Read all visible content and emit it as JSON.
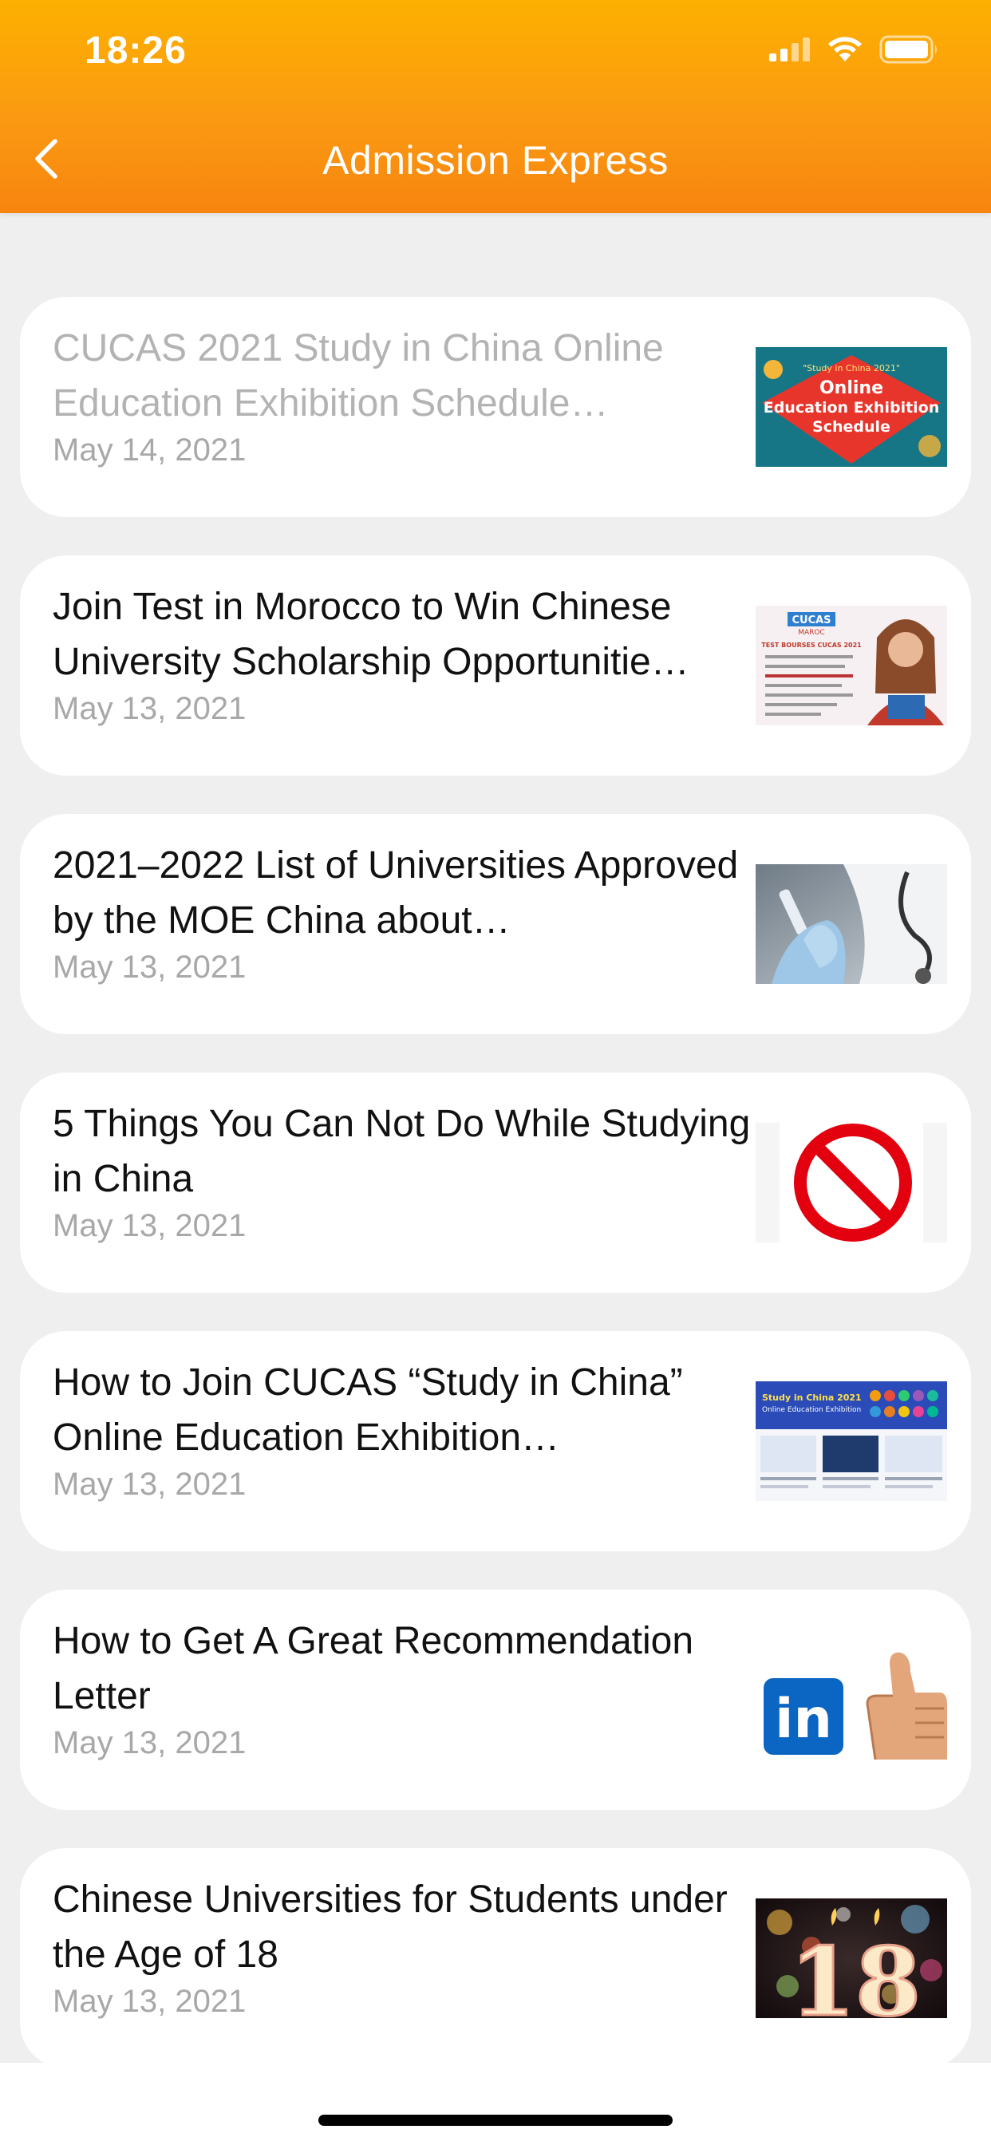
{
  "status_bar": {
    "time": "18:26",
    "icons": [
      "cellular-signal-icon",
      "wifi-icon",
      "battery-icon"
    ]
  },
  "nav": {
    "back_icon": "chevron-left-icon",
    "title": "Admission Express"
  },
  "theme": {
    "header_gradient_top": "#fdb000",
    "header_gradient_bottom": "#f7850f",
    "read_title_color": "#b3b3b3",
    "date_color": "#a8a8a8"
  },
  "articles": [
    {
      "title": "CUCAS 2021 Study in China Online Education Exhibition Schedule…",
      "date": "May 14, 2021",
      "read": true,
      "thumb": {
        "kind": "exhibition-poster",
        "line1": "\"Study in China 2021\"",
        "line2": "Online",
        "line3": "Education Exhibition",
        "line4": "Schedule"
      }
    },
    {
      "title": "Join Test in Morocco to Win Chinese University Scholarship Opportunitie…",
      "date": "May 13, 2021",
      "read": false,
      "thumb": {
        "kind": "morocco-flyer",
        "line1": "CUCAS",
        "line2": "MAROC",
        "line3": "TEST BOURSES CUCAS 2021"
      }
    },
    {
      "title": "2021–2022 List of Universities Approved by the MOE China about…",
      "date": "May 13, 2021",
      "read": false,
      "thumb": {
        "kind": "doctor-photo"
      }
    },
    {
      "title": "5 Things You Can Not Do While Studying in China",
      "date": "May 13, 2021",
      "read": false,
      "thumb": {
        "kind": "prohibited-sign"
      }
    },
    {
      "title": "How to Join CUCAS “Study in China” Online Education Exhibition…",
      "date": "May 13, 2021",
      "read": false,
      "thumb": {
        "kind": "website-screenshot",
        "line1": "Study in China 2021",
        "line2": "Online Education Exhibition"
      }
    },
    {
      "title": "How to Get A Great Recommendation Letter",
      "date": "May 13, 2021",
      "read": false,
      "thumb": {
        "kind": "linkedin-thumbs-up",
        "logo_text": "in"
      }
    },
    {
      "title": "Chinese Universities for Students under the Age of 18",
      "date": "May 13, 2021",
      "read": false,
      "thumb": {
        "kind": "birthday-candles",
        "number": "18"
      }
    }
  ]
}
